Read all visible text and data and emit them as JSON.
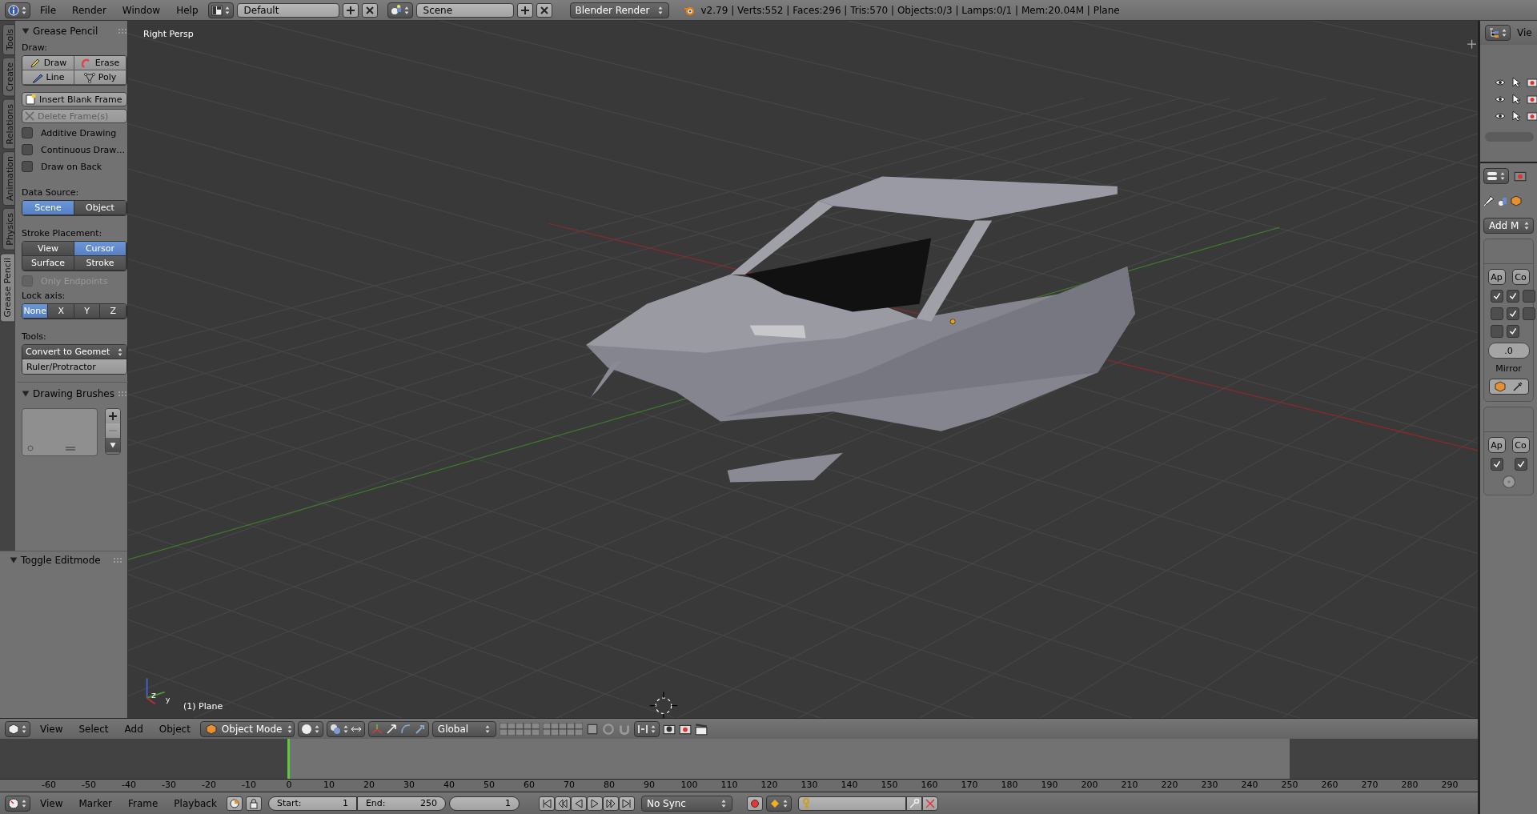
{
  "top_bar": {
    "menus": [
      "File",
      "Render",
      "Window",
      "Help"
    ],
    "screen_layout": "Default",
    "scene": "Scene",
    "render_engine": "Blender Render",
    "stats": "v2.79 | Verts:552 | Faces:296 | Tris:570 | Objects:0/3 | Lamps:0/1 | Mem:20.04M | Plane"
  },
  "left_tabs": [
    {
      "label": "Tools",
      "selected": false
    },
    {
      "label": "Create",
      "selected": false
    },
    {
      "label": "Relations",
      "selected": false
    },
    {
      "label": "Animation",
      "selected": false
    },
    {
      "label": "Physics",
      "selected": false
    },
    {
      "label": "Grease Pencil",
      "selected": true
    }
  ],
  "grease_pencil": {
    "title": "Grease Pencil",
    "expanded": true,
    "draw_label": "Draw:",
    "draw_buttons": [
      {
        "label": "Draw",
        "kind": "pencil"
      },
      {
        "label": "Erase",
        "kind": "eraser"
      },
      {
        "label": "Line",
        "kind": "line"
      },
      {
        "label": "Poly",
        "kind": "poly"
      }
    ],
    "frame_buttons": [
      {
        "label": "Insert Blank Frame",
        "disabled": false
      },
      {
        "label": "Delete Frame(s)",
        "disabled": true
      }
    ],
    "options": [
      {
        "label": "Additive Drawing",
        "checked": false,
        "disabled": false
      },
      {
        "label": "Continuous Draw…",
        "checked": false,
        "disabled": false
      },
      {
        "label": "Draw on Back",
        "checked": false,
        "disabled": false
      }
    ],
    "data_source": {
      "label": "Data Source:",
      "choices": [
        {
          "label": "Scene",
          "selected": true
        },
        {
          "label": "Object",
          "selected": false
        }
      ]
    },
    "stroke_placement": {
      "label": "Stroke Placement:",
      "choices": [
        {
          "label": "View",
          "selected": false
        },
        {
          "label": "Cursor",
          "selected": true
        },
        {
          "label": "Surface",
          "selected": false
        },
        {
          "label": "Stroke",
          "selected": false
        }
      ]
    },
    "only_endpoints": {
      "label": "Only Endpoints",
      "checked": false,
      "disabled": true
    },
    "lock_axis": {
      "label": "Lock axis:",
      "choices": [
        {
          "label": "None",
          "selected": true
        },
        {
          "label": "X",
          "selected": false
        },
        {
          "label": "Y",
          "selected": false
        },
        {
          "label": "Z",
          "selected": false
        }
      ]
    },
    "tools": {
      "label": "Tools:",
      "convert": "Convert to Geomet",
      "ruler": "Ruler/Protractor"
    }
  },
  "drawing_brushes": {
    "title": "Drawing Brushes",
    "expanded": true
  },
  "toggle_editmode": {
    "title": "Toggle Editmode",
    "expanded": true
  },
  "viewport": {
    "view_name": "Right Persp",
    "object_name": "(1) Plane",
    "gizmo_labels": [
      "z",
      "y"
    ]
  },
  "outliner": {
    "header": "Vie"
  },
  "properties": {
    "add_modifier": "Add M",
    "modifiers": [
      {
        "buttons": [
          "Ap",
          "Co"
        ],
        "checks": [
          [
            true,
            true,
            false
          ],
          [
            false,
            true,
            false
          ],
          [
            false,
            true
          ]
        ],
        "field": ".0",
        "label": "Mirror"
      },
      {
        "buttons": [
          "Ap",
          "Co"
        ],
        "checks": [
          [
            true,
            true
          ]
        ]
      }
    ]
  },
  "view3d_header": {
    "menus": [
      "View",
      "Select",
      "Add",
      "Object"
    ],
    "mode": "Object Mode",
    "orientation": "Global"
  },
  "timeline": {
    "ticks": [
      "-60",
      "-50",
      "-40",
      "-30",
      "-20",
      "-10",
      "0",
      "10",
      "20",
      "30",
      "40",
      "50",
      "60",
      "70",
      "80",
      "90",
      "100",
      "110",
      "120",
      "130",
      "140",
      "150",
      "160",
      "170",
      "180",
      "190",
      "200",
      "210",
      "220",
      "230",
      "240",
      "250",
      "260",
      "270",
      "280",
      "290"
    ]
  },
  "timeline_header": {
    "menus": [
      "View",
      "Marker",
      "Frame",
      "Playback"
    ],
    "start": {
      "label": "Start:",
      "value": "1"
    },
    "end": {
      "label": "End:",
      "value": "250"
    },
    "current_frame": "1",
    "sync": "No Sync"
  }
}
